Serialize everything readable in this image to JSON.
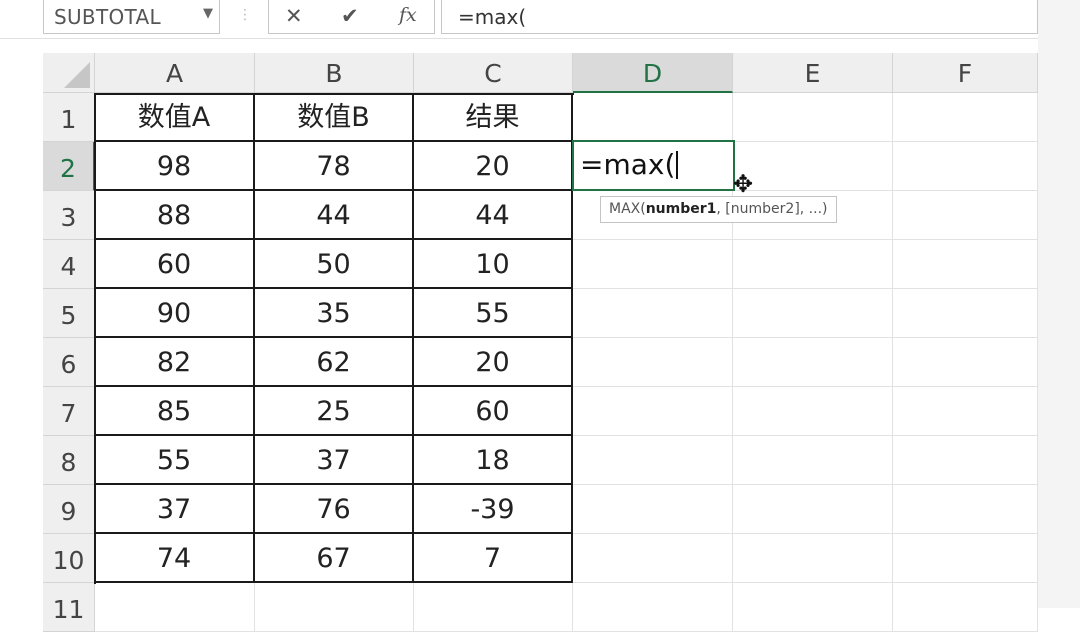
{
  "formula_bar": {
    "name_box": "SUBTOTAL",
    "cancel_glyph": "✕",
    "enter_glyph": "✔",
    "fx_label": "fx",
    "formula": "=max("
  },
  "columns": [
    "A",
    "B",
    "C",
    "D",
    "E",
    "F"
  ],
  "active_column": "D",
  "rows": [
    "1",
    "2",
    "3",
    "4",
    "5",
    "6",
    "7",
    "8",
    "9",
    "10",
    "11"
  ],
  "active_row": "2",
  "table": {
    "headers": [
      "数值A",
      "数值B",
      "结果"
    ],
    "rows": [
      [
        "98",
        "78",
        "20"
      ],
      [
        "88",
        "44",
        "44"
      ],
      [
        "60",
        "50",
        "10"
      ],
      [
        "90",
        "35",
        "55"
      ],
      [
        "82",
        "62",
        "20"
      ],
      [
        "85",
        "25",
        "60"
      ],
      [
        "55",
        "37",
        "18"
      ],
      [
        "37",
        "76",
        "-39"
      ],
      [
        "74",
        "67",
        "7"
      ]
    ]
  },
  "active_cell": {
    "ref": "D2",
    "value": "=max("
  },
  "tooltip": {
    "func": "MAX(",
    "arg1": "number1",
    "rest": ", [number2], ...)"
  },
  "colors": {
    "accent": "#217346",
    "header_bg": "#efefef",
    "grid": "#e2e2e2"
  }
}
